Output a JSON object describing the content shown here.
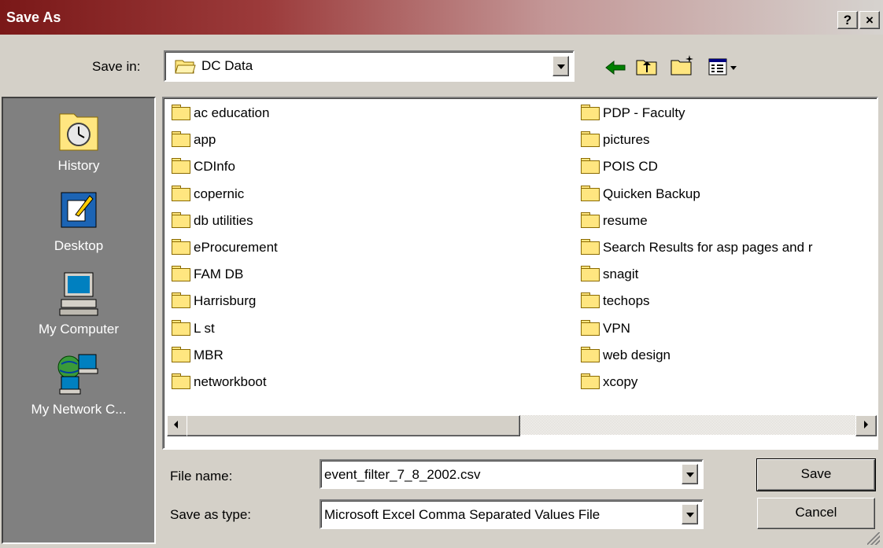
{
  "dialog": {
    "title": "Save As",
    "help_button": "?",
    "close_button": "×"
  },
  "save_in": {
    "label": "Save in:",
    "value": "DC Data"
  },
  "places": [
    {
      "label": "History",
      "icon": "history-icon"
    },
    {
      "label": "Desktop",
      "icon": "desktop-icon"
    },
    {
      "label": "My Computer",
      "icon": "my-computer-icon"
    },
    {
      "label": "My Network C...",
      "icon": "my-network-icon"
    }
  ],
  "files": {
    "left": [
      "ac education",
      "app",
      "CDInfo",
      "copernic",
      "db utilities",
      "eProcurement",
      "FAM DB",
      "Harrisburg",
      "L st",
      "MBR",
      "networkboot"
    ],
    "right": [
      "PDP - Faculty",
      "pictures",
      "POIS CD",
      "Quicken Backup",
      "resume",
      "Search Results for asp pages and r",
      "snagit",
      "techops",
      "VPN",
      "web design",
      "xcopy"
    ]
  },
  "file_name": {
    "label": "File name:",
    "value": "event_filter_7_8_2002.csv"
  },
  "save_as_type": {
    "label": "Save as type:",
    "value": "Microsoft Excel Comma Separated Values File"
  },
  "buttons": {
    "save": "Save",
    "cancel": "Cancel"
  },
  "colors": {
    "title_start": "#7a1818",
    "title_end": "#d6d3cf",
    "places_bg": "#808080",
    "folder": "#ffe680",
    "face": "#d4d0c8"
  }
}
